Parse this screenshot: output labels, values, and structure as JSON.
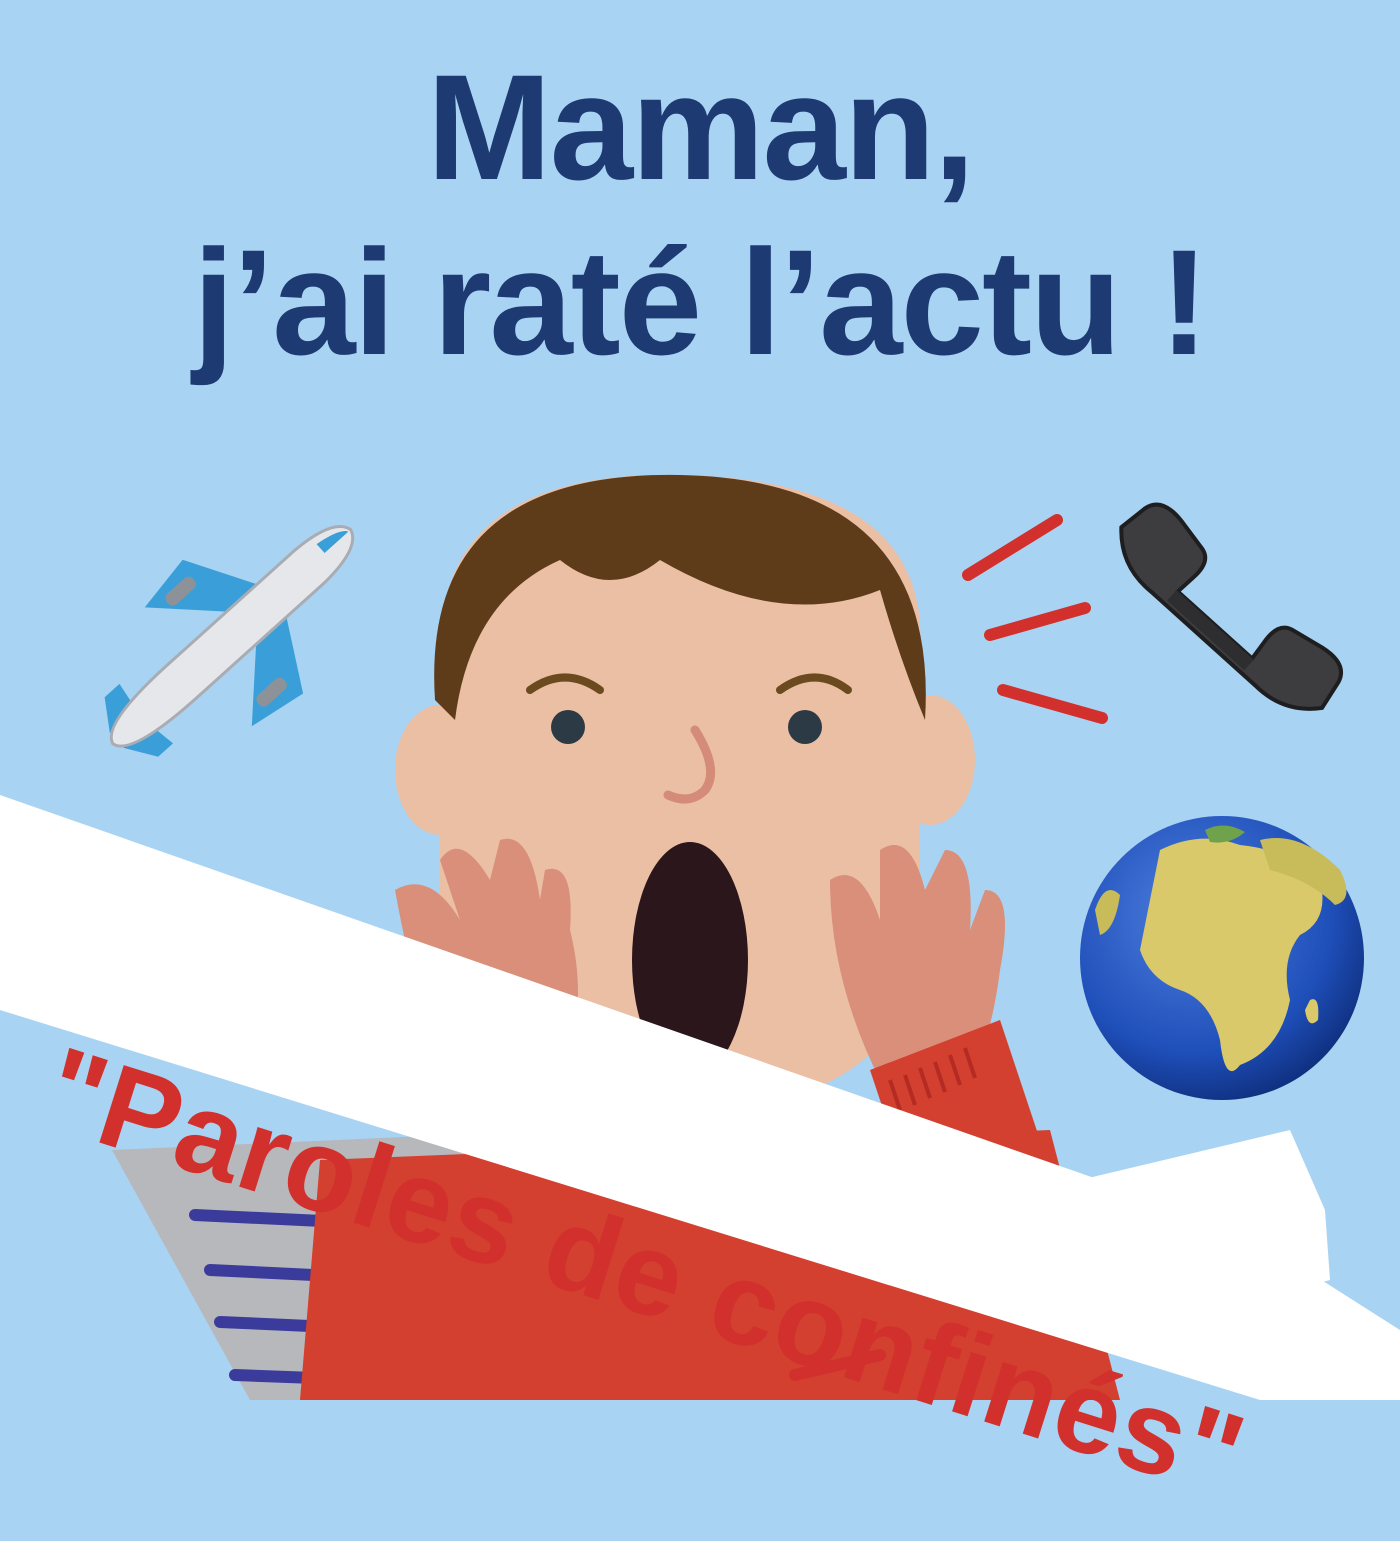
{
  "title": {
    "line1": "Maman,",
    "line2": "j’ai raté l’actu !"
  },
  "banner": {
    "text": "\"Paroles de confinés\""
  },
  "icons": [
    "airplane-icon",
    "telephone-icon",
    "globe-icon",
    "newspaper-icon",
    "person-illustration"
  ],
  "colors": {
    "background": "#a9d3f2",
    "title": "#1d3a73",
    "banner_text": "#d2302c",
    "banner_bg": "#ffffff",
    "hair": "#5e3b19",
    "skin": "#ebbfa4",
    "sweater": "#d3402f"
  }
}
